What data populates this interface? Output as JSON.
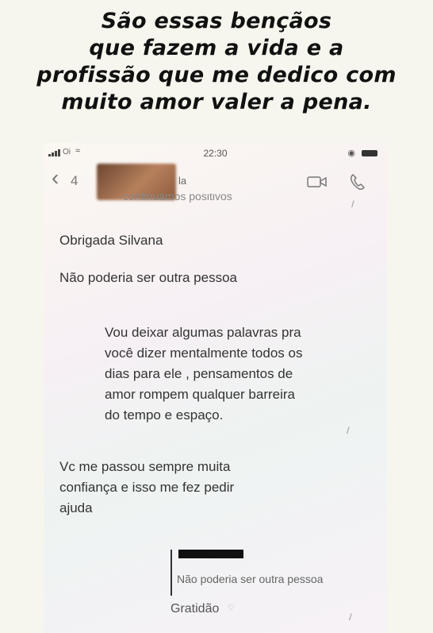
{
  "caption": {
    "lines": [
      "São essas bençãos",
      "que fazem a vida e a",
      "profissão que me dedico com",
      "muito amor valer a pena."
    ]
  },
  "status_bar": {
    "carrier": "Oi",
    "time": "22:30"
  },
  "nav": {
    "back_count": "4",
    "contact_name_partial": "la"
  },
  "chat": {
    "cut_off_text": "continuamos positivos",
    "messages": [
      {
        "lines": [
          "Obrigada Silvana"
        ]
      },
      {
        "lines": [
          "Não poderia ser outra pessoa"
        ]
      },
      {
        "lines": [
          "Vou deixar algumas palavras pra",
          "você dizer mentalmente todos os",
          "dias para ele , pensamentos de",
          "amor rompem qualquer barreira",
          "do tempo e espaço."
        ]
      },
      {
        "lines": [
          "Vc me passou sempre muita",
          "confiança e isso me fez pedir",
          "ajuda"
        ]
      }
    ],
    "reply": {
      "quoted_text": "Não poderia ser outra pessoa",
      "text": "Gratidão"
    }
  },
  "icons": {
    "back": "chevron-left-icon",
    "video": "video-camera-icon",
    "call": "phone-icon",
    "wifi": "wifi-icon",
    "read_receipt": "double-check-icon"
  },
  "colors": {
    "text": "#333333",
    "caption": "#111111",
    "muted": "#888888"
  }
}
